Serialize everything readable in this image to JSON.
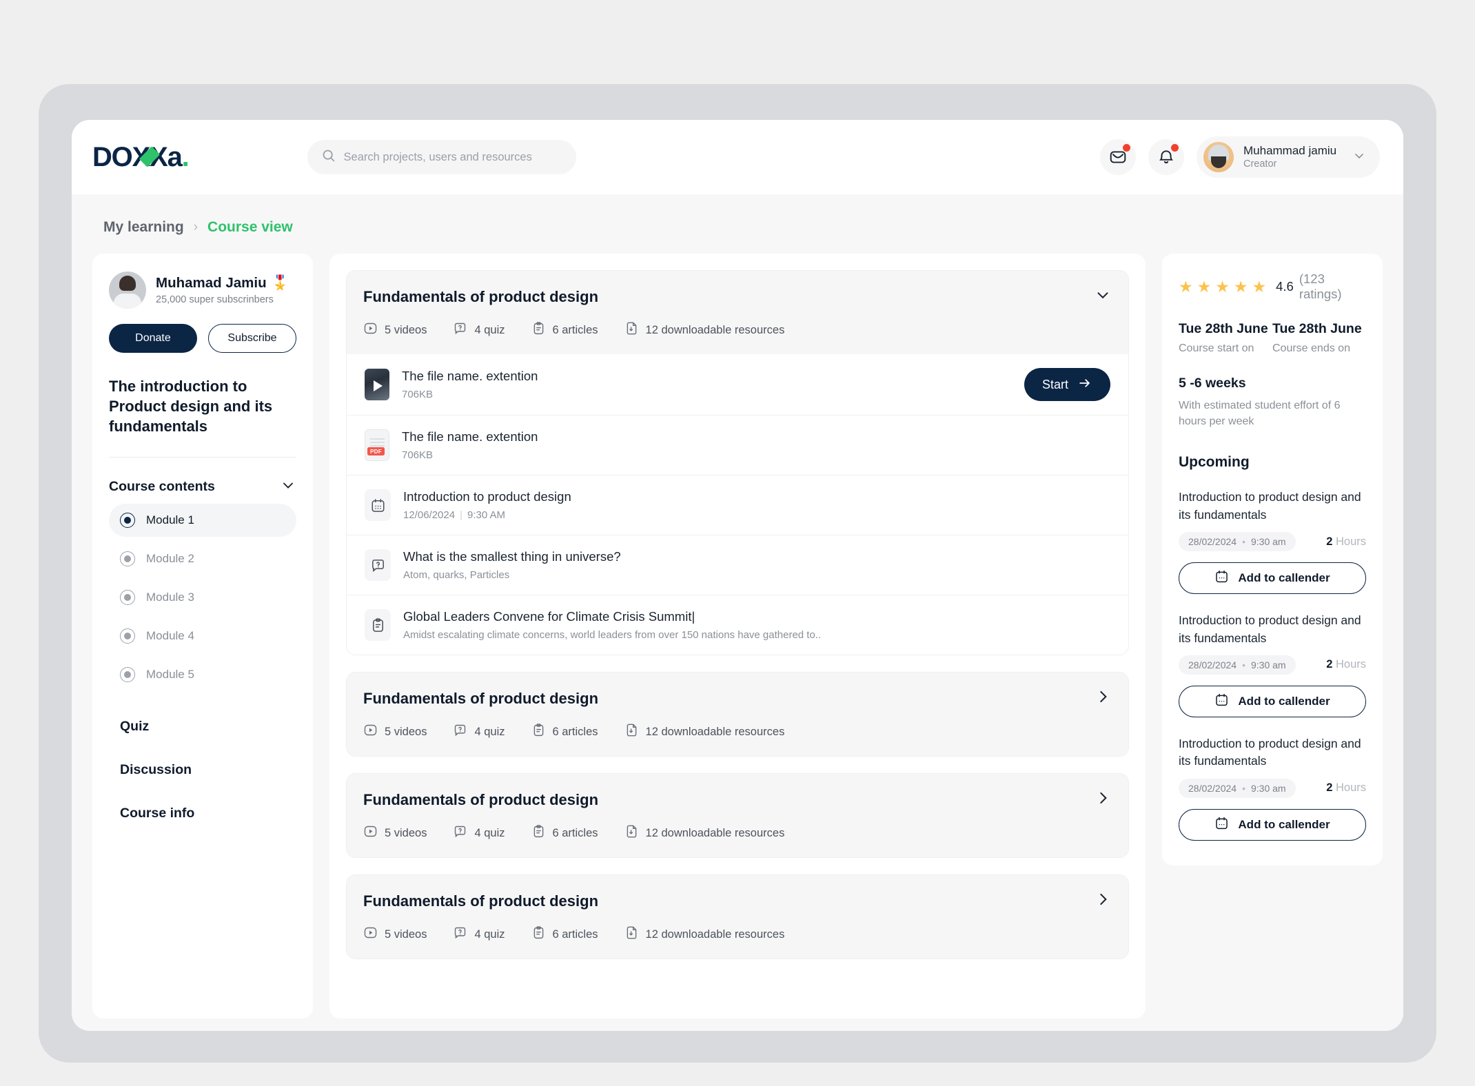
{
  "brand": {
    "logo_text_1": "DO",
    "logo_text_x": "X",
    "logo_text_x2": "X",
    "logo_text_2": "a",
    "logo_dot": ".",
    "accent_green": "#2ec26b",
    "navy": "#0b2545"
  },
  "topbar": {
    "search_placeholder": "Search projects, users and resources",
    "search_value": "",
    "mail_icon": "mail-icon",
    "bell_icon": "bell-icon",
    "profile_name": "Muhammad jamiu",
    "profile_role": "Creator"
  },
  "breadcrumb": {
    "parent": "My learning",
    "separator": "›",
    "current": "Course view"
  },
  "sidebar": {
    "creator_name": "Muhamad Jamiu",
    "creator_badge": "🎖️",
    "creator_subscribers": "25,000 super subscrinbers",
    "donate_label": "Donate",
    "subscribe_label": "Subscribe",
    "course_title": "The introduction to Product design and its fundamentals",
    "contents_label": "Course contents",
    "modules": [
      {
        "label": "Module 1",
        "active": true
      },
      {
        "label": "Module 2",
        "active": false
      },
      {
        "label": "Module 3",
        "active": false
      },
      {
        "label": "Module 4",
        "active": false
      },
      {
        "label": "Module 5",
        "active": false
      }
    ],
    "links": [
      {
        "label": "Quiz"
      },
      {
        "label": "Discussion"
      },
      {
        "label": "Course info"
      }
    ]
  },
  "main": {
    "sections": [
      {
        "title": "Fundamentals of product design",
        "expanded": true,
        "chevron": "∨",
        "meta": [
          {
            "icon": "play-circle-icon",
            "label": "5 videos"
          },
          {
            "icon": "question-bubble-icon",
            "label": "4 quiz"
          },
          {
            "icon": "clipboard-icon",
            "label": "6 articles"
          },
          {
            "icon": "file-download-icon",
            "label": "12 downloadable resources"
          }
        ],
        "lessons": [
          {
            "kind": "video",
            "title": "The file name. extention",
            "sub": "706KB",
            "action": "Start"
          },
          {
            "kind": "pdf",
            "title": "The file name. extention",
            "sub": "706KB"
          },
          {
            "kind": "calendar",
            "title": "Introduction to product design",
            "sub_date": "12/06/2024",
            "sub_time": "9:30 AM"
          },
          {
            "kind": "question",
            "title": "What is the smallest thing in universe?",
            "sub": "Atom, quarks, Particles"
          },
          {
            "kind": "article",
            "title": "Global Leaders Convene for Climate Crisis Summit|",
            "sub": "Amidst escalating climate concerns, world leaders from over 150 nations have gathered to.."
          }
        ]
      },
      {
        "title": "Fundamentals of product design",
        "expanded": false,
        "chevron": "›",
        "meta": [
          {
            "icon": "play-circle-icon",
            "label": "5 videos"
          },
          {
            "icon": "question-bubble-icon",
            "label": "4 quiz"
          },
          {
            "icon": "clipboard-icon",
            "label": "6 articles"
          },
          {
            "icon": "file-download-icon",
            "label": "12 downloadable resources"
          }
        ]
      },
      {
        "title": "Fundamentals of product design",
        "expanded": false,
        "chevron": "›",
        "meta": [
          {
            "icon": "play-circle-icon",
            "label": "5 videos"
          },
          {
            "icon": "question-bubble-icon",
            "label": "4 quiz"
          },
          {
            "icon": "clipboard-icon",
            "label": "6 articles"
          },
          {
            "icon": "file-download-icon",
            "label": "12 downloadable resources"
          }
        ]
      },
      {
        "title": "Fundamentals of product design",
        "expanded": false,
        "chevron": "›",
        "meta": [
          {
            "icon": "play-circle-icon",
            "label": "5 videos"
          },
          {
            "icon": "question-bubble-icon",
            "label": "4 quiz"
          },
          {
            "icon": "clipboard-icon",
            "label": "6 articles"
          },
          {
            "icon": "file-download-icon",
            "label": "12 downloadable resources"
          }
        ]
      }
    ]
  },
  "rightbar": {
    "stars_filled": 5,
    "star_glyph": "★",
    "star_color": "#fcc24c",
    "rating_value": "4.6",
    "rating_count": "(123 ratings)",
    "start_date": "Tue 28th June",
    "start_label": "Course start on",
    "end_date": "Tue 28th June",
    "end_label": "Course ends on",
    "duration": "5 -6 weeks",
    "duration_note": "With estimated student effort of 6 hours per week",
    "upcoming_heading": "Upcoming",
    "upcoming": [
      {
        "title": "Introduction to product design and its fundamentals",
        "date": "28/02/2024",
        "dot": "•",
        "time": "9:30 am",
        "hours_value": "2",
        "hours_label": "Hours",
        "button_label": "Add to callender"
      },
      {
        "title": "Introduction to product design and its fundamentals",
        "date": "28/02/2024",
        "dot": "•",
        "time": "9:30 am",
        "hours_value": "2",
        "hours_label": "Hours",
        "button_label": "Add to callender"
      },
      {
        "title": "Introduction to product design and its fundamentals",
        "date": "28/02/2024",
        "dot": "•",
        "time": "9:30 am",
        "hours_value": "2",
        "hours_label": "Hours",
        "button_label": "Add to callender"
      }
    ]
  }
}
